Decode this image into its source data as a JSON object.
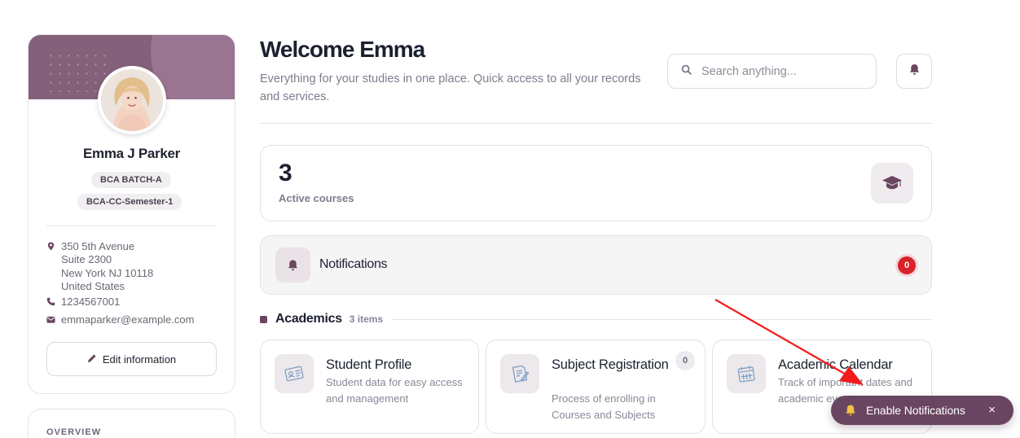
{
  "profile": {
    "name": "Emma J Parker",
    "batch": "BCA BATCH-A",
    "semester": "BCA-CC-Semester-1",
    "address": [
      "350 5th Avenue",
      "Suite 2300",
      "New York NJ 10118",
      "United States"
    ],
    "phone": "1234567001",
    "email": "emmaparker@example.com",
    "edit_label": "Edit information",
    "overview_label": "OVERVIEW"
  },
  "header": {
    "title": "Welcome Emma",
    "subtitle": "Everything for your studies in one place. Quick access to all your records and services.",
    "search_placeholder": "Search anything..."
  },
  "stats": {
    "active_courses_value": "3",
    "active_courses_label": "Active courses"
  },
  "notifications": {
    "label": "Notifications",
    "count": "0"
  },
  "academics": {
    "title": "Academics",
    "count_label": "3 items",
    "tiles": [
      {
        "title": "Student Profile",
        "description": "Student data for easy access and management"
      },
      {
        "title": "Subject Registration",
        "description": "Process of enrolling in Courses and Subjects",
        "count": "0"
      },
      {
        "title": "Academic Calendar",
        "description": "Track of important dates and academic events"
      }
    ]
  },
  "toast": {
    "label": "Enable Notifications",
    "close": "×"
  },
  "colors": {
    "brand": "#6a4561",
    "badge_red": "#d8232a"
  }
}
